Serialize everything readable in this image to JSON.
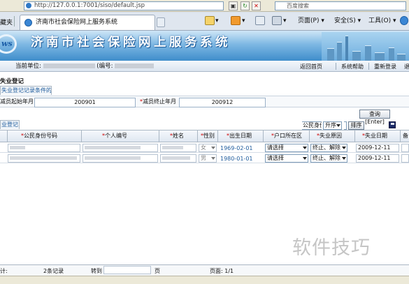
{
  "browser": {
    "address_url": "http://127.0.0.1:7001/siso/default.jsp",
    "search_placeholder": "百度搜索",
    "favorites_label": "藏夹",
    "tab_title": "济南市社会保险网上服务系统",
    "toolbar": {
      "page_label": "页面(P)",
      "safety_label": "安全(S)",
      "tools_label": "工具(O)"
    }
  },
  "app": {
    "banner_logo": "ws",
    "banner_title": "济南市社会保险网上服务系统",
    "current_unit_label": "当前单位:",
    "unit_code_label": "(编号:",
    "nav": [
      "返回首页",
      "系统帮助",
      "重新登录",
      "退"
    ]
  },
  "page": {
    "title": "失业登记",
    "subtab_label": "失业登记记录条件的职工",
    "filter": {
      "start_label": "减员起始年月",
      "start_value": "200901",
      "end_label": "减员终止年月",
      "end_value": "200912",
      "query_button": "查询[Enter]"
    },
    "grid": {
      "tab_label": "业登记",
      "sort_field": "公民身份号码",
      "sort_order": "升序",
      "sort_button": "排序",
      "columns": [
        "公民身份号码",
        "个人编号",
        "姓名",
        "性别",
        "出生日期",
        "户口所在区",
        "失业原因",
        "失业日期",
        "备"
      ],
      "rows": [
        {
          "gender": "女",
          "birth_date": "1969-02-01",
          "district": "请选择",
          "reason": "终止、解除",
          "unemp_date": "2009-12-11"
        },
        {
          "gender": "男",
          "birth_date": "1980-01-01",
          "district": "请选择",
          "reason": "终止、解除",
          "unemp_date": "2009-12-11"
        }
      ]
    },
    "footer": {
      "total_label": "计:",
      "record_count": "2条记录",
      "goto_label": "转到",
      "page_unit": "页",
      "page_info_label": "页面: 1/1"
    }
  },
  "watermark": "软件技巧",
  "colors": {
    "banner_blue": "#3f8dcb",
    "link_blue": "#1f5c9d",
    "required_star": "#cc0000"
  }
}
